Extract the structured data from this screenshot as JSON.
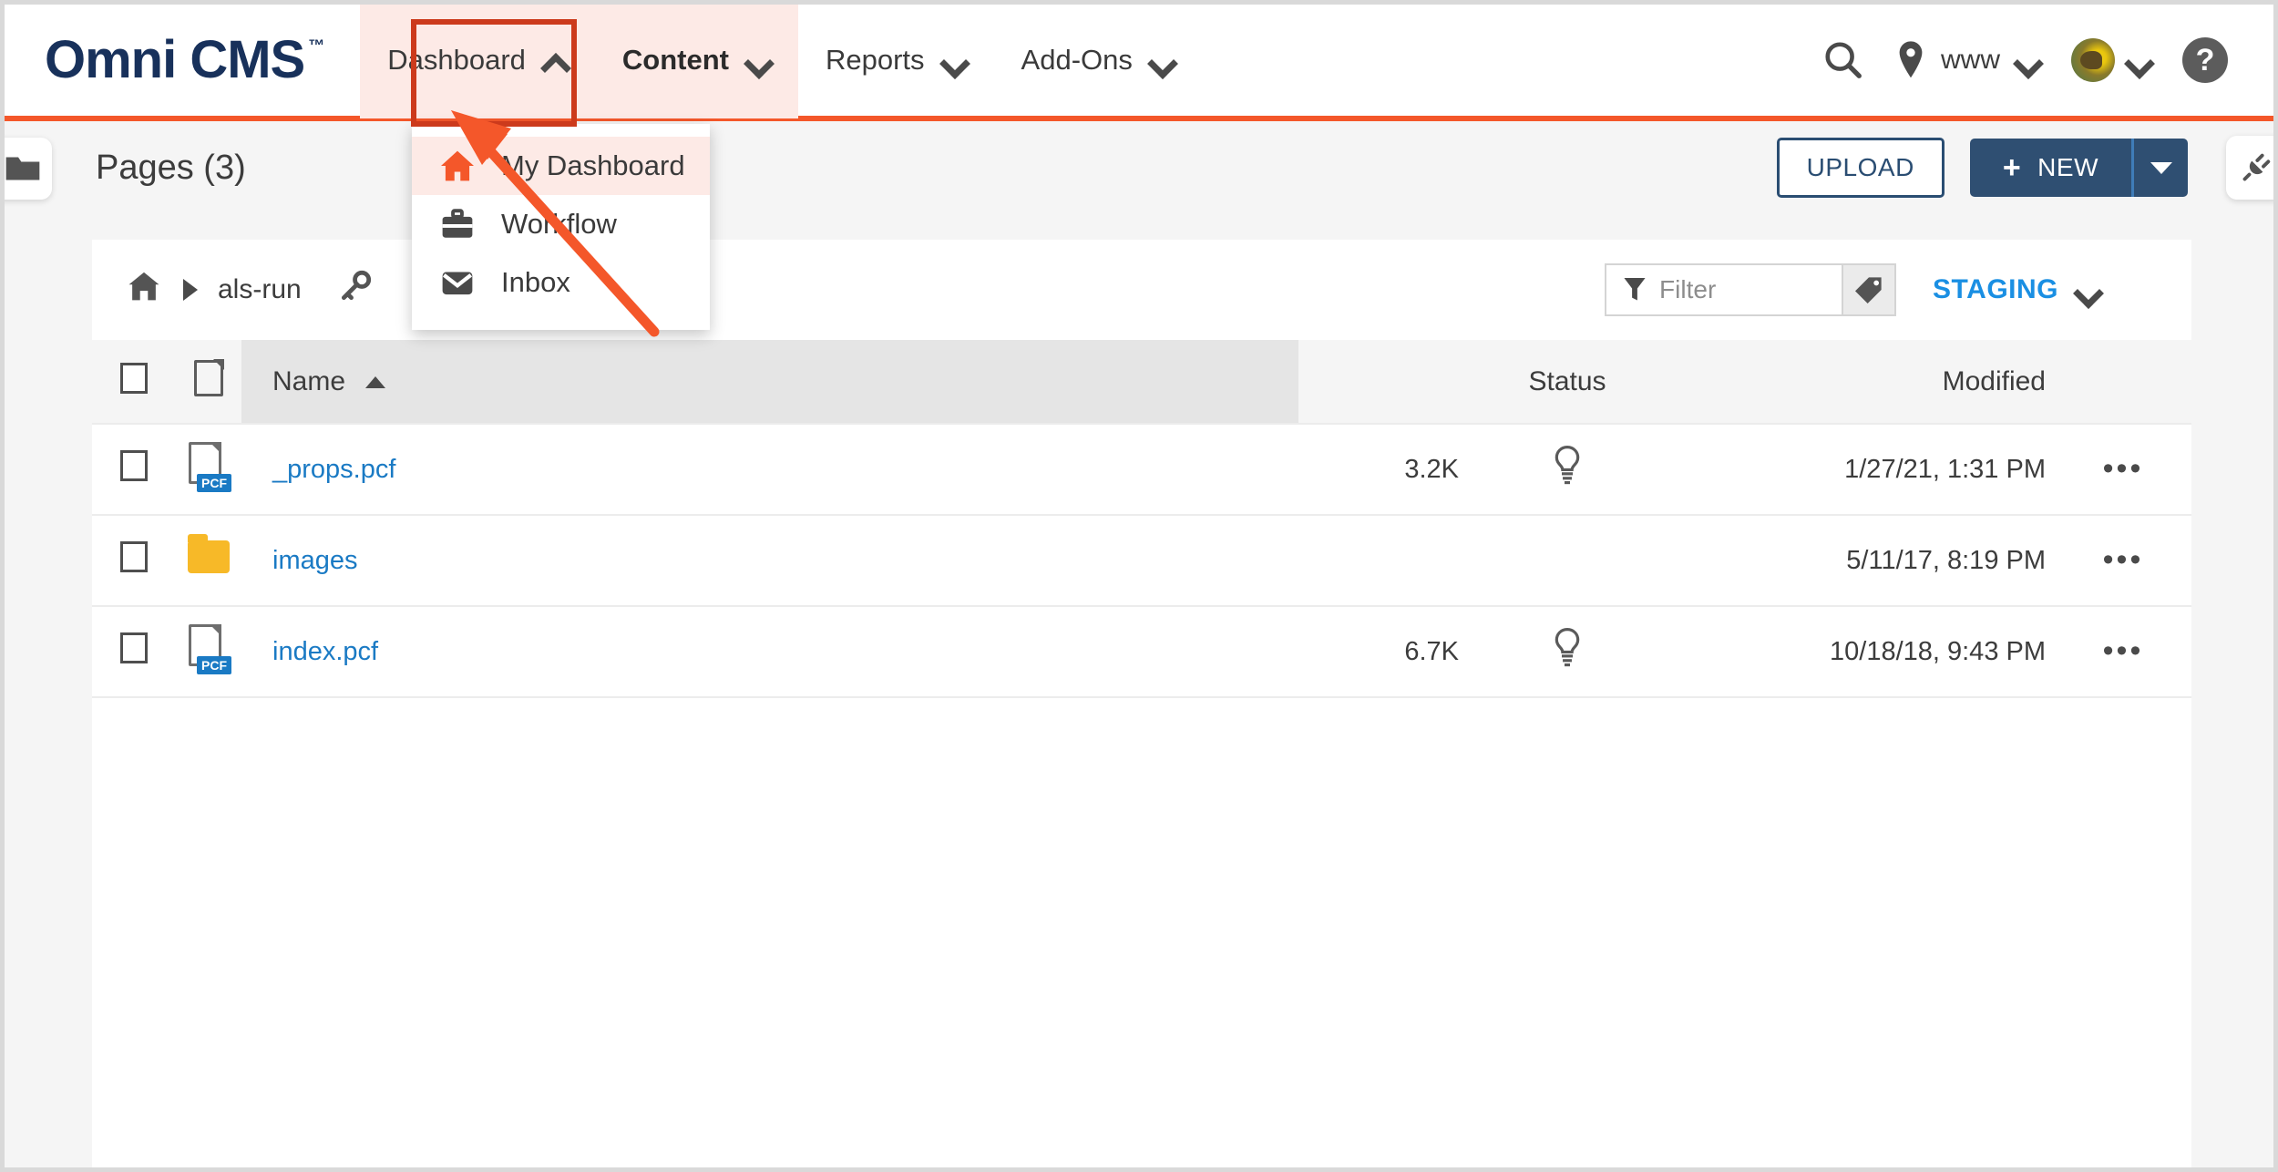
{
  "brand": {
    "name": "Omni CMS",
    "tm": "™"
  },
  "nav": {
    "items": [
      {
        "label": "Dashboard",
        "chevron": "chevron-up",
        "state": "open"
      },
      {
        "label": "Content",
        "chevron": "chevron-down",
        "state": "active"
      },
      {
        "label": "Reports",
        "chevron": "chevron-down",
        "state": "normal"
      },
      {
        "label": "Add-Ons",
        "chevron": "chevron-down",
        "state": "normal"
      }
    ],
    "right": {
      "search_icon": "search-icon",
      "location_icon": "location-pin-icon",
      "site_label": "www",
      "site_chevron": "chevron-down",
      "avatar": "user-avatar",
      "avatar_chevron": "chevron-down",
      "help_label": "?"
    }
  },
  "dropdown": {
    "open_for": "Dashboard",
    "items": [
      {
        "label": "My Dashboard",
        "icon": "home-icon",
        "highlighted": true
      },
      {
        "label": "Workflow",
        "icon": "briefcase-icon",
        "highlighted": false
      },
      {
        "label": "Inbox",
        "icon": "envelope-icon",
        "highlighted": false
      }
    ]
  },
  "page_header": {
    "folder_tab_icon": "folder-icon",
    "title": "Pages (3)",
    "upload_label": "UPLOAD",
    "new_label": "NEW",
    "new_plus": "+",
    "plug_tab_icon": "plug-icon"
  },
  "toolbar": {
    "breadcrumb": [
      {
        "label": "",
        "icon": "home-icon"
      },
      {
        "label": "als-run",
        "icon": ""
      }
    ],
    "key_icon": "key-icon",
    "filter_placeholder": "Filter",
    "filter_value": "",
    "filter_icon": "funnel-icon",
    "tag_icon": "tag-icon",
    "environment": "STAGING",
    "environment_chevron": "chevron-down"
  },
  "table": {
    "columns": [
      "",
      "",
      "Name",
      "",
      "Status",
      "Modified",
      ""
    ],
    "headers": {
      "name": "Name",
      "status": "Status",
      "modified": "Modified"
    },
    "sort_column": "Name",
    "sort_direction": "asc",
    "rows": [
      {
        "name": "_props.pcf",
        "icon": "pcf-file-icon",
        "badge": "PCF",
        "size": "3.2K",
        "status": "lightbulb-icon",
        "modified": "1/27/21, 1:31 PM",
        "menu": "•••"
      },
      {
        "name": "images",
        "icon": "folder-icon",
        "badge": "",
        "size": "",
        "status": "",
        "modified": "5/11/17, 8:19 PM",
        "menu": "•••"
      },
      {
        "name": "index.pcf",
        "icon": "pcf-file-icon",
        "badge": "PCF",
        "size": "6.7K",
        "status": "lightbulb-icon",
        "modified": "10/18/18, 9:43 PM",
        "menu": "•••"
      }
    ]
  },
  "annotation": {
    "highlight_target": "Dashboard",
    "arrow_points_to": "My Dashboard",
    "color": "#f4572a",
    "box_color": "#cc3a1c"
  },
  "colors": {
    "brand_navy": "#18315b",
    "accent_orange": "#f4572a",
    "link_blue": "#1a7ac4",
    "staging_blue": "#1a8fe3",
    "button_navy": "#2f4f72",
    "folder_yellow": "#f7b928"
  }
}
